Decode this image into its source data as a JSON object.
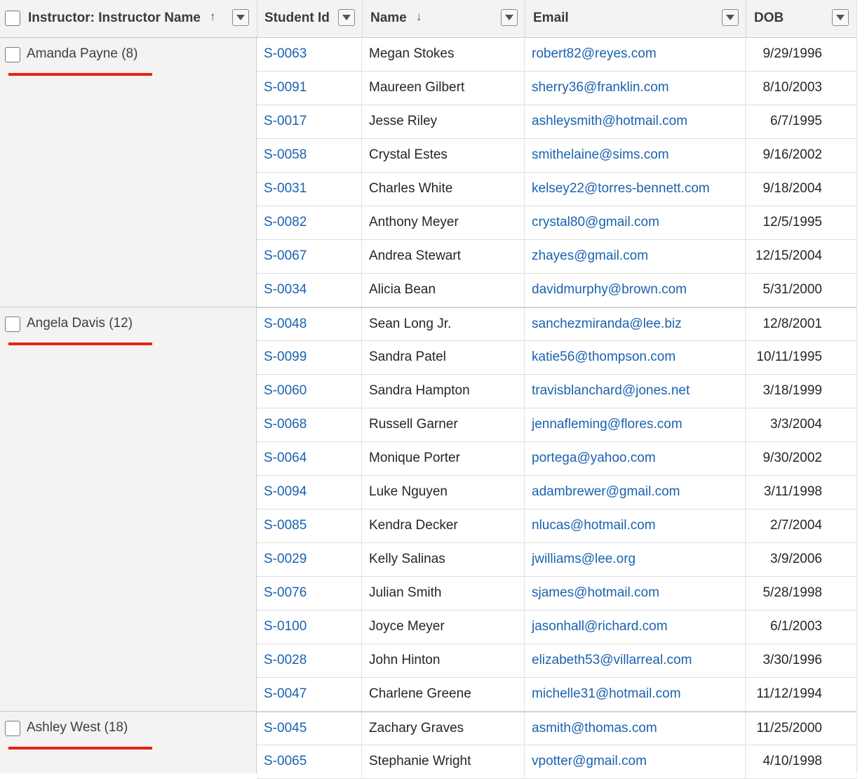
{
  "colors": {
    "link": "#1a62b0",
    "marker": "#e8240f",
    "header_bg": "#f3f3f3"
  },
  "header": {
    "instructor_col": "Instructor: Instructor Name",
    "instructor_sort": "↑",
    "student_id_col": "Student Id",
    "name_col": "Name",
    "name_sort": "↓",
    "email_col": "Email",
    "dob_col": "DOB"
  },
  "groups": [
    {
      "label": "Amanda Payne (8)"
    },
    {
      "label": "Angela Davis (12)"
    },
    {
      "label": "Ashley West (18)"
    }
  ],
  "rows": [
    {
      "id": "S-0063",
      "name": "Megan Stokes",
      "email": "robert82@reyes.com",
      "dob": "9/29/1996"
    },
    {
      "id": "S-0091",
      "name": "Maureen Gilbert",
      "email": "sherry36@franklin.com",
      "dob": "8/10/2003"
    },
    {
      "id": "S-0017",
      "name": "Jesse Riley",
      "email": "ashleysmith@hotmail.com",
      "dob": "6/7/1995"
    },
    {
      "id": "S-0058",
      "name": "Crystal Estes",
      "email": "smithelaine@sims.com",
      "dob": "9/16/2002"
    },
    {
      "id": "S-0031",
      "name": "Charles White",
      "email": "kelsey22@torres-bennett.com",
      "dob": "9/18/2004"
    },
    {
      "id": "S-0082",
      "name": "Anthony Meyer",
      "email": "crystal80@gmail.com",
      "dob": "12/5/1995"
    },
    {
      "id": "S-0067",
      "name": "Andrea Stewart",
      "email": "zhayes@gmail.com",
      "dob": "12/15/2004"
    },
    {
      "id": "S-0034",
      "name": "Alicia Bean",
      "email": "davidmurphy@brown.com",
      "dob": "5/31/2000"
    },
    {
      "id": "S-0048",
      "name": "Sean Long Jr.",
      "email": "sanchezmiranda@lee.biz",
      "dob": "12/8/2001"
    },
    {
      "id": "S-0099",
      "name": "Sandra Patel",
      "email": "katie56@thompson.com",
      "dob": "10/11/1995"
    },
    {
      "id": "S-0060",
      "name": "Sandra Hampton",
      "email": "travisblanchard@jones.net",
      "dob": "3/18/1999"
    },
    {
      "id": "S-0068",
      "name": "Russell Garner",
      "email": "jennafleming@flores.com",
      "dob": "3/3/2004"
    },
    {
      "id": "S-0064",
      "name": "Monique Porter",
      "email": "portega@yahoo.com",
      "dob": "9/30/2002"
    },
    {
      "id": "S-0094",
      "name": "Luke Nguyen",
      "email": "adambrewer@gmail.com",
      "dob": "3/11/1998"
    },
    {
      "id": "S-0085",
      "name": "Kendra Decker",
      "email": "nlucas@hotmail.com",
      "dob": "2/7/2004"
    },
    {
      "id": "S-0029",
      "name": "Kelly Salinas",
      "email": "jwilliams@lee.org",
      "dob": "3/9/2006"
    },
    {
      "id": "S-0076",
      "name": "Julian Smith",
      "email": "sjames@hotmail.com",
      "dob": "5/28/1998"
    },
    {
      "id": "S-0100",
      "name": "Joyce Meyer",
      "email": "jasonhall@richard.com",
      "dob": "6/1/2003"
    },
    {
      "id": "S-0028",
      "name": "John Hinton",
      "email": "elizabeth53@villarreal.com",
      "dob": "3/30/1996"
    },
    {
      "id": "S-0047",
      "name": "Charlene Greene",
      "email": "michelle31@hotmail.com",
      "dob": "11/12/1994"
    },
    {
      "id": "S-0045",
      "name": "Zachary Graves",
      "email": "asmith@thomas.com",
      "dob": "11/25/2000"
    },
    {
      "id": "S-0065",
      "name": "Stephanie Wright",
      "email": "vpotter@gmail.com",
      "dob": "4/10/1998"
    }
  ]
}
